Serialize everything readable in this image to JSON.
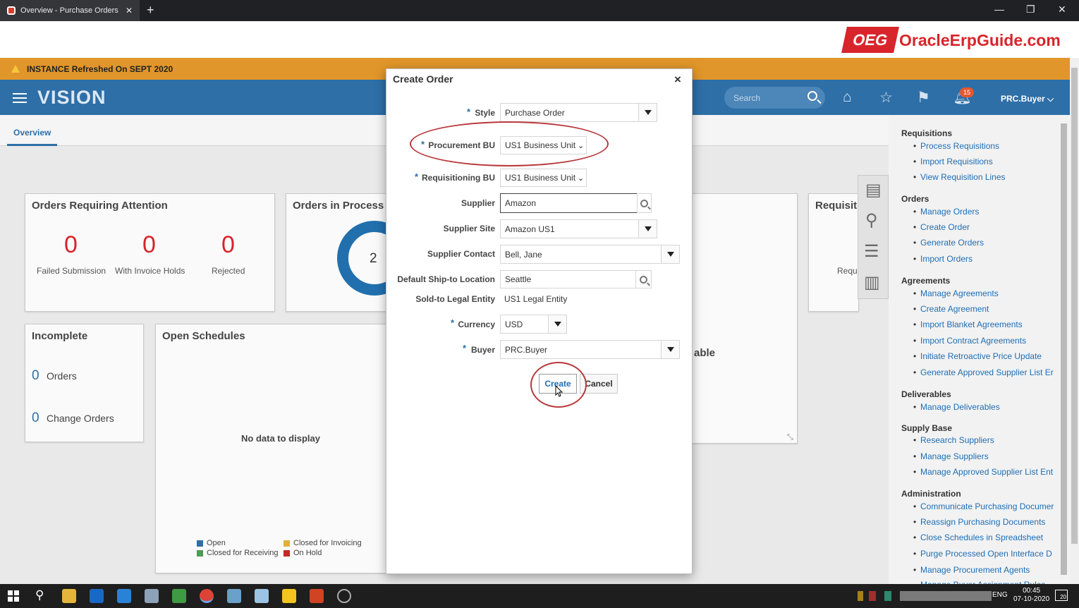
{
  "browser": {
    "tab_title": "Overview - Purchase Orders - Or",
    "tab_close": "✕",
    "new_tab": "+",
    "min": "—",
    "max": "❐",
    "close": "✕"
  },
  "watermark": {
    "box": "OEG",
    "text": "OracleErpGuide.com"
  },
  "banner": {
    "text": "INSTANCE Refreshed On SEPT 2020"
  },
  "header": {
    "brand": "VISION",
    "search_placeholder": "Search",
    "notification_count": "15",
    "user": "PRC.Buyer ⌵"
  },
  "page": {
    "tab": "Overview",
    "cards": {
      "attention": {
        "title": "Orders Requiring Attention",
        "metrics": [
          {
            "value": "0",
            "label": "Failed Submission"
          },
          {
            "value": "0",
            "label": "With Invoice Holds"
          },
          {
            "value": "0",
            "label": "Rejected"
          }
        ]
      },
      "in_process": {
        "title": "Orders in Process",
        "donut_value": "2"
      },
      "requisitions": {
        "title": "Requisit",
        "sub": "Requ"
      },
      "unavailable": {
        "text": "able"
      },
      "incomplete": {
        "title": "Incomplete",
        "rows": [
          {
            "count": "0",
            "label": "Orders"
          },
          {
            "count": "0",
            "label": "Change Orders"
          }
        ]
      },
      "open_schedules": {
        "title": "Open Schedules",
        "empty": "No data to display",
        "legend": [
          {
            "label": "Open",
            "color": "#2e6fa7"
          },
          {
            "label": "Closed for Invoicing",
            "color": "#e0b23a"
          },
          {
            "label": "Closed for Receiving",
            "color": "#4f9a55"
          },
          {
            "label": "On Hold",
            "color": "#c62828"
          }
        ]
      }
    }
  },
  "tasks": {
    "sections": [
      {
        "title": "Requisitions",
        "links": [
          "Process Requisitions",
          "Import Requisitions",
          "View Requisition Lines"
        ]
      },
      {
        "title": "Orders",
        "links": [
          "Manage Orders",
          "Create Order",
          "Generate Orders",
          "Import Orders"
        ]
      },
      {
        "title": "Agreements",
        "links": [
          "Manage Agreements",
          "Create Agreement",
          "Import Blanket Agreements",
          "Import Contract Agreements",
          "Initiate Retroactive Price Update",
          "Generate Approved Supplier List Er"
        ]
      },
      {
        "title": "Deliverables",
        "links": [
          "Manage Deliverables"
        ]
      },
      {
        "title": "Supply Base",
        "links": [
          "Research Suppliers",
          "Manage Suppliers",
          "Manage Approved Supplier List Ent"
        ]
      },
      {
        "title": "Administration",
        "links": [
          "Communicate Purchasing Documer",
          "Reassign Purchasing Documents",
          "Close Schedules in Spreadsheet",
          "Purge Processed Open Interface D",
          "Manage Procurement Agents",
          "Manage Buyer Assignment Rules"
        ]
      }
    ]
  },
  "dialog": {
    "title": "Create Order",
    "close": "×",
    "required_mark": "*",
    "fields": {
      "style": {
        "label": "Style",
        "value": "Purchase Order"
      },
      "procurement_bu": {
        "label": "Procurement BU",
        "value": "US1 Business Unit"
      },
      "requisitioning_bu": {
        "label": "Requisitioning BU",
        "value": "US1 Business Unit"
      },
      "supplier": {
        "label": "Supplier",
        "value": "Amazon"
      },
      "supplier_site": {
        "label": "Supplier Site",
        "value": "Amazon US1"
      },
      "supplier_contact": {
        "label": "Supplier Contact",
        "value": "Bell, Jane"
      },
      "ship_to": {
        "label": "Default Ship-to Location",
        "value": "Seattle"
      },
      "legal_entity": {
        "label": "Sold-to Legal Entity",
        "value": "US1 Legal Entity"
      },
      "currency": {
        "label": "Currency",
        "value": "USD"
      },
      "buyer": {
        "label": "Buyer",
        "value": "PRC.Buyer"
      }
    },
    "buttons": {
      "create": "Create",
      "cancel": "Cancel"
    }
  },
  "taskbar": {
    "lang": "ENG",
    "time": "00:45",
    "date": "07-10-2020",
    "notif": "20"
  }
}
